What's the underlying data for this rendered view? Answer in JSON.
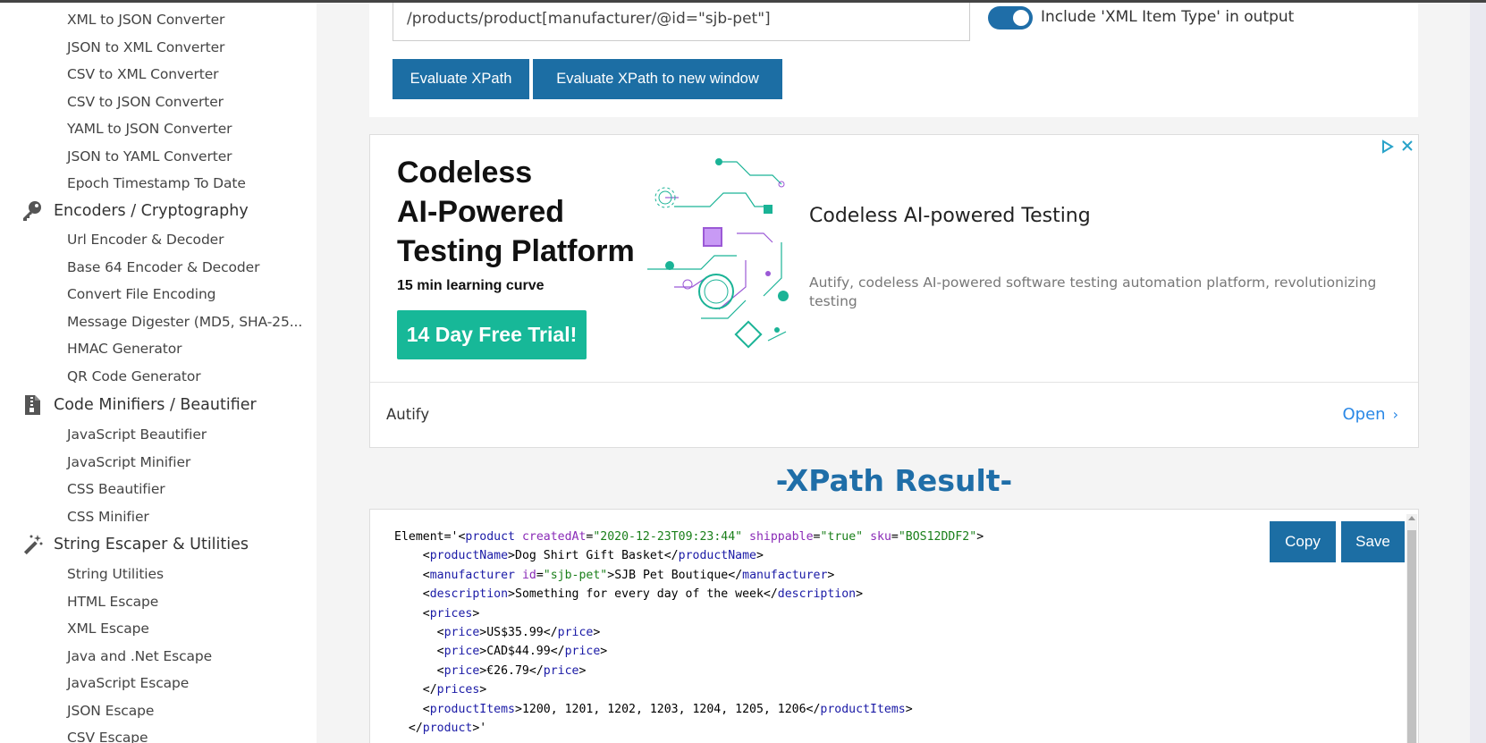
{
  "sidebar": {
    "items_a": [
      "XML to JSON Converter",
      "JSON to XML Converter",
      "CSV to XML Converter",
      "CSV to JSON Converter",
      "YAML to JSON Converter",
      "JSON to YAML Converter",
      "Epoch Timestamp To Date"
    ],
    "cat_encoders": "Encoders / Cryptography",
    "items_b": [
      "Url Encoder & Decoder",
      "Base 64 Encoder & Decoder",
      "Convert File Encoding",
      "Message Digester (MD5, SHA-25...",
      "HMAC Generator",
      "QR Code Generator"
    ],
    "cat_minifiers": "Code Minifiers / Beautifier",
    "items_c": [
      "JavaScript Beautifier",
      "JavaScript Minifier",
      "CSS Beautifier",
      "CSS Minifier"
    ],
    "cat_string": "String Escaper & Utilities",
    "items_d": [
      "String Utilities",
      "HTML Escape",
      "XML Escape",
      "Java and .Net Escape",
      "JavaScript Escape",
      "JSON Escape",
      "CSV Escape"
    ],
    "icons": {
      "encoders": "key-icon",
      "minifiers": "zip-file-icon",
      "string": "magic-wand-icon"
    }
  },
  "form": {
    "xpath_value": "/products/product[manufacturer/@id=\"sjb-pet\"]",
    "toggle_label": "Include 'XML Item Type' in output",
    "toggle_on": true,
    "evaluate_label": "Evaluate XPath",
    "evaluate_new_label": "Evaluate XPath to new window"
  },
  "ad": {
    "headline_1": "Codeless",
    "headline_2": "AI-Powered",
    "headline_3": "Testing Platform",
    "subline": "15 min learning curve",
    "cta": "14 Day Free Trial!",
    "title": "Codeless AI-powered Testing",
    "description": "Autify, codeless AI-powered software testing automation platform, revolutionizing testing",
    "brand": "Autify",
    "open_label": "Open",
    "accent_color": "#17b898"
  },
  "result": {
    "title": "-XPath Result-",
    "copy_label": "Copy",
    "save_label": "Save",
    "line1": {
      "prefix": "Element='<",
      "tag": "product",
      "a1": "createdAt",
      "v1": "\"2020-12-23T09:23:44\"",
      "a2": "shippable",
      "v2": "\"true\"",
      "a3": "sku",
      "v3": "\"BOS12DDF2\""
    },
    "productName_tag": "productName",
    "productName_val": "Dog Shirt Gift Basket",
    "manufacturer_tag": "manufacturer",
    "manufacturer_attr": "id",
    "manufacturer_attr_val": "\"sjb-pet\"",
    "manufacturer_val": "SJB Pet Boutique",
    "description_tag": "description",
    "description_val": "Something for every day of the week",
    "prices_tag": "prices",
    "price_tag": "price",
    "price_1": "US$35.99",
    "price_2": "CAD$44.99",
    "price_3": "€26.79",
    "productItems_tag": "productItems",
    "productItems_val": "1200, 1201, 1202, 1203, 1204, 1205, 1206",
    "closing_tag": "product",
    "closing_suffix": "'"
  },
  "colors": {
    "primary": "#1c6ea4",
    "title": "#1f6ea8",
    "tag": "#1a1aa6",
    "attr": "#8a2bb7",
    "value": "#1a7f1a"
  }
}
